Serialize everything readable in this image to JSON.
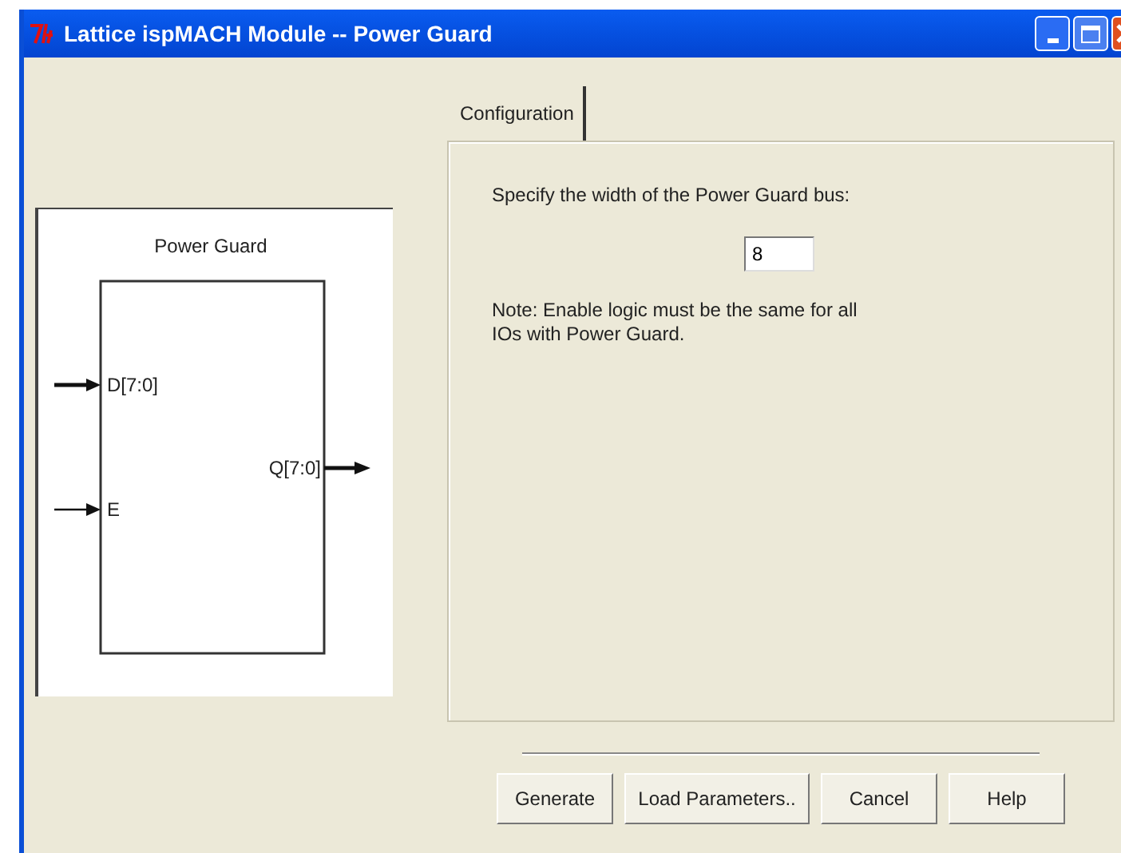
{
  "window": {
    "title": "Lattice ispMACH Module -- Power Guard"
  },
  "diagram": {
    "title": "Power Guard",
    "inputs": [
      {
        "label": "D[7:0]",
        "kind": "bus"
      },
      {
        "label": "E",
        "kind": "wire"
      }
    ],
    "outputs": [
      {
        "label": "Q[7:0]",
        "kind": "bus"
      }
    ]
  },
  "tabs": [
    {
      "label": "Configuration",
      "selected": true
    }
  ],
  "config": {
    "prompt": "Specify the width of the Power Guard bus:",
    "width_value": "8",
    "note": "Note: Enable logic must be the same for all IOs with Power Guard."
  },
  "buttons": [
    "Generate",
    "Load Parameters..",
    "Cancel",
    "Help"
  ]
}
